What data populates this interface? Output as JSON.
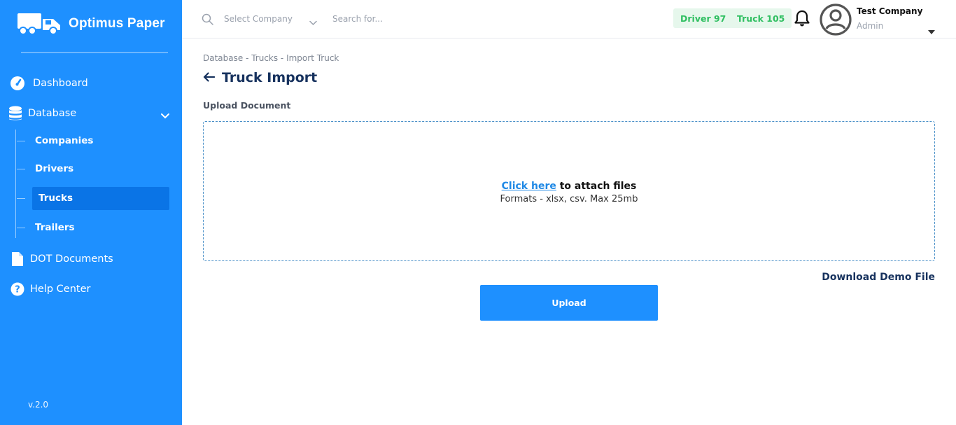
{
  "brand": {
    "name": "Optimus Paper",
    "logo_icon": "truck-logo-icon"
  },
  "sidebar": {
    "items": [
      {
        "label": "Dashboard",
        "icon": "gauge-icon"
      },
      {
        "label": "Database",
        "icon": "database-icon"
      },
      {
        "label": "DOT Documents",
        "icon": "document-icon"
      },
      {
        "label": "Help Center",
        "icon": "help-icon"
      }
    ],
    "database_children": [
      {
        "label": "Companies",
        "active": false
      },
      {
        "label": "Drivers",
        "active": false
      },
      {
        "label": "Trucks",
        "active": true
      },
      {
        "label": "Trailers",
        "active": false
      }
    ],
    "version": "v.2.0"
  },
  "topbar": {
    "select_company_placeholder": "Select Company",
    "search_placeholder": "Search for...",
    "badges": {
      "driver": "Driver 97",
      "truck": "Truck 105"
    },
    "user": {
      "company": "Test Company",
      "role": "Admin"
    }
  },
  "main": {
    "breadcrumb": "Database - Trucks - Import Truck",
    "title": "Truck Import",
    "upload_label": "Upload Document",
    "dropzone": {
      "link_text": "Click here",
      "link_suffix": " to attach files",
      "formats": "Formats - xlsx, csv. Max 25mb"
    },
    "download_demo": "Download Demo File",
    "upload_button": "Upload"
  },
  "colors": {
    "sidebar_bg": "#1e90ff",
    "sidebar_active": "#0a74e6",
    "title": "#17325e",
    "badge_bg": "#e6f7ec",
    "badge_text": "#2fbf61",
    "link": "#1e88e5"
  }
}
